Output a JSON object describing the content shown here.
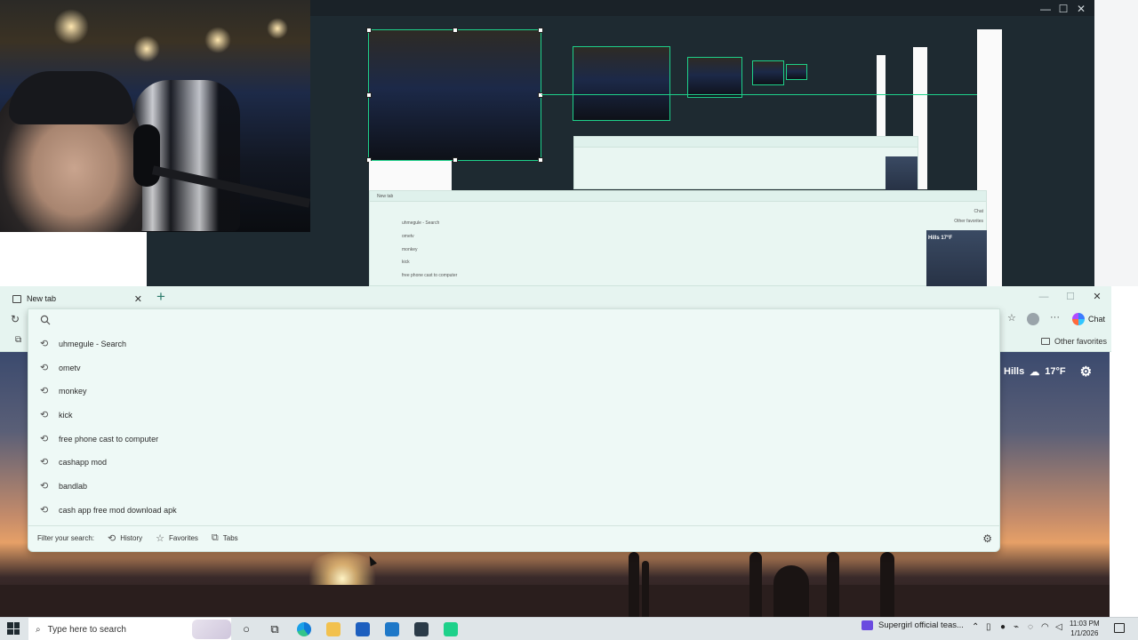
{
  "capture": {
    "window_controls": {
      "minimize": "—",
      "maximize": "☐",
      "close": "✕"
    },
    "mini_suggestions": [
      "uhmegule - Search",
      "ometv",
      "monkey",
      "kick",
      "free phone cast to computer"
    ],
    "mini_tab_title": "New tab",
    "mini_weather": "Hills 17°F",
    "mini_chat": "Chat",
    "mini_other_favorites": "Other favorites"
  },
  "browser": {
    "tab": {
      "title": "New tab",
      "close": "✕"
    },
    "new_tab": "+",
    "window_controls": {
      "minimize": "—",
      "maximize": "☐",
      "close": "✕"
    },
    "toolbar": {
      "reload": "↻",
      "more": "···",
      "chat": "Chat",
      "favorites_star": "☆"
    },
    "favorites_bar": {
      "other_favorites": "Other favorites"
    },
    "weather": {
      "location": "Hills",
      "temp": "17°F",
      "gear": "⚙"
    }
  },
  "omnibox": {
    "value": "",
    "placeholder": "",
    "suggestions": [
      {
        "text": "uhmegule - Search"
      },
      {
        "text": "ometv"
      },
      {
        "text": "monkey"
      },
      {
        "text": "kick"
      },
      {
        "text": "free phone cast to computer"
      },
      {
        "text": "cashapp mod"
      },
      {
        "text": "bandlab"
      },
      {
        "text": "cash app free mod download apk"
      }
    ],
    "filter_label": "Filter your search:",
    "filters": [
      {
        "icon": "history-icon",
        "label": "History"
      },
      {
        "icon": "star-icon",
        "label": "Favorites"
      },
      {
        "icon": "tabs-icon",
        "label": "Tabs"
      }
    ]
  },
  "taskbar": {
    "search_placeholder": "Type here to search",
    "notification_app": "Supergirl official teas...",
    "time": "11:03 PM",
    "date": "1/1/2026"
  },
  "colors": {
    "browser_frame": "#e6f4f0",
    "dropdown_bg": "#eef9f6",
    "selection_green": "#1ed18a",
    "taskbar": "#dfe5e8"
  }
}
